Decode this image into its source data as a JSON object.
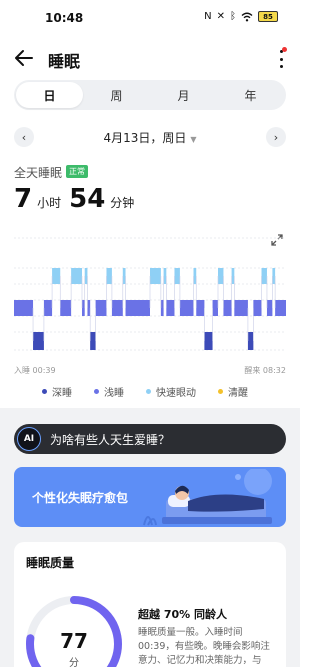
{
  "status_bar": {
    "time": "10:48",
    "icons": [
      "nfc-icon",
      "mute-icon",
      "bluetooth-icon",
      "wifi-icon",
      "battery-icon"
    ],
    "battery": "85"
  },
  "header": {
    "title": "睡眠"
  },
  "tabs": [
    {
      "label": "日",
      "active": true
    },
    {
      "label": "周",
      "active": false
    },
    {
      "label": "月",
      "active": false
    },
    {
      "label": "年",
      "active": false
    }
  ],
  "date_nav": {
    "prev": "‹",
    "date": "4月13日，周日",
    "caret": "▼",
    "next": "›"
  },
  "summary": {
    "label": "全天睡眠",
    "badge": "正常",
    "hours": "7",
    "hours_unit": "小时",
    "minutes": "54",
    "minutes_unit": "分钟"
  },
  "chart": {
    "start_label": "入睡 00:39",
    "end_label": "醒来 08:32",
    "colors": {
      "deep": "#3d4bb8",
      "light": "#6a72e6",
      "rem": "#8fd0f5",
      "awake": "#f3c12b"
    },
    "segments": [
      [
        "light",
        0.0,
        0.07
      ],
      [
        "deep",
        0.07,
        0.11
      ],
      [
        "light",
        0.11,
        0.14
      ],
      [
        "rem",
        0.14,
        0.17
      ],
      [
        "light",
        0.17,
        0.21
      ],
      [
        "rem",
        0.21,
        0.25
      ],
      [
        "light",
        0.25,
        0.26
      ],
      [
        "rem",
        0.26,
        0.27
      ],
      [
        "light",
        0.27,
        0.28
      ],
      [
        "deep",
        0.28,
        0.3
      ],
      [
        "light",
        0.3,
        0.34
      ],
      [
        "rem",
        0.34,
        0.36
      ],
      [
        "light",
        0.36,
        0.4
      ],
      [
        "rem",
        0.4,
        0.41
      ],
      [
        "light",
        0.41,
        0.5
      ],
      [
        "rem",
        0.5,
        0.54
      ],
      [
        "light",
        0.54,
        0.55
      ],
      [
        "rem",
        0.55,
        0.56
      ],
      [
        "light",
        0.56,
        0.59
      ],
      [
        "rem",
        0.59,
        0.61
      ],
      [
        "light",
        0.61,
        0.66
      ],
      [
        "rem",
        0.66,
        0.67
      ],
      [
        "light",
        0.67,
        0.7
      ],
      [
        "deep",
        0.7,
        0.73
      ],
      [
        "light",
        0.73,
        0.75
      ],
      [
        "rem",
        0.75,
        0.77
      ],
      [
        "light",
        0.77,
        0.8
      ],
      [
        "rem",
        0.8,
        0.81
      ],
      [
        "light",
        0.81,
        0.86
      ],
      [
        "deep",
        0.86,
        0.88
      ],
      [
        "light",
        0.88,
        0.91
      ],
      [
        "rem",
        0.91,
        0.93
      ],
      [
        "light",
        0.93,
        0.95
      ],
      [
        "rem",
        0.95,
        0.96
      ],
      [
        "light",
        0.96,
        1.0
      ]
    ]
  },
  "legend": [
    {
      "label": "深睡",
      "color": "#3d4bb8"
    },
    {
      "label": "浅睡",
      "color": "#6a72e6"
    },
    {
      "label": "快速眼动",
      "color": "#8fd0f5"
    },
    {
      "label": "清醒",
      "color": "#f3c12b"
    }
  ],
  "question": {
    "icon_text": "AI",
    "text": "为啥有些人天生爱睡？"
  },
  "banner": {
    "text": "个性化失眠疗愈包"
  },
  "quality": {
    "title": "睡眠质量",
    "score": "77",
    "score_unit": "分",
    "score_value": 77,
    "beat": "超越 70% 同龄人",
    "description": "睡眠质量一般。入睡时间 00:39，有些晚。晚睡会影响注意力、记忆力和决策能力，与"
  }
}
